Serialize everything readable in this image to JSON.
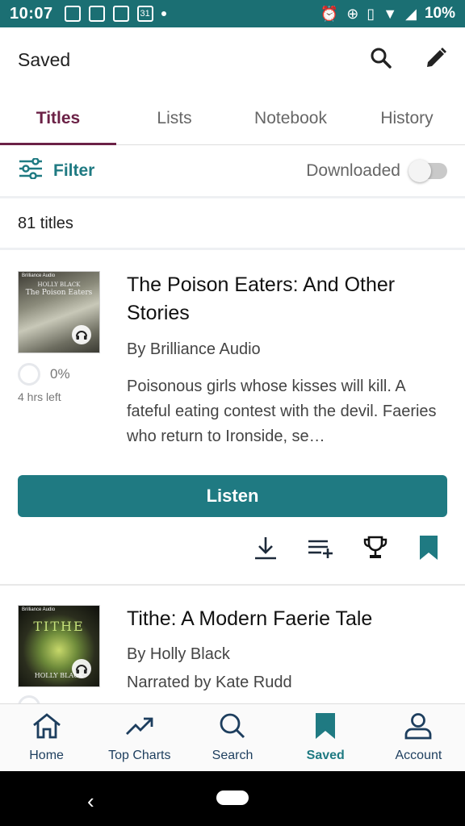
{
  "status_bar": {
    "time": "10:07",
    "calendar_day": "31",
    "battery": "10%"
  },
  "header": {
    "title": "Saved",
    "search_icon": "search-icon",
    "edit_icon": "edit-icon"
  },
  "tabs": [
    {
      "label": "Titles",
      "active": true
    },
    {
      "label": "Lists",
      "active": false
    },
    {
      "label": "Notebook",
      "active": false
    },
    {
      "label": "History",
      "active": false
    }
  ],
  "filter_bar": {
    "filter_label": "Filter",
    "downloaded_label": "Downloaded",
    "downloaded_on": false
  },
  "count_label": "81 titles",
  "books": [
    {
      "cover_brand": "Brilliance Audio",
      "cover_title": "The Poison Eaters",
      "cover_author": "HOLLY BLACK",
      "title": "The Poison Eaters: And Other Stories",
      "byline": "By Brilliance Audio",
      "description": "Poisonous girls whose kisses will kill. A fateful eating contest with the devil. Faeries who return to Ironside, se…",
      "progress": "0%",
      "time_left": "4 hrs left",
      "listen_label": "Listen"
    },
    {
      "cover_brand": "Brilliance Audio",
      "cover_title": "TITHE",
      "cover_author": "HOLLY BLACK",
      "title": "Tithe: A Modern Faerie Tale",
      "byline": "By Holly Black",
      "narrator": "Narrated by Kate Rudd"
    }
  ],
  "bottom_nav": [
    {
      "label": "Home",
      "icon": "home-icon",
      "active": false
    },
    {
      "label": "Top Charts",
      "icon": "trending-icon",
      "active": false
    },
    {
      "label": "Search",
      "icon": "search-icon",
      "active": false
    },
    {
      "label": "Saved",
      "icon": "bookmark-icon",
      "active": true
    },
    {
      "label": "Account",
      "icon": "account-icon",
      "active": false
    }
  ],
  "colors": {
    "status_bar": "#1b6f73",
    "accent": "#1f7a82",
    "tab_active": "#6b2146",
    "nav": "#1d3e5e"
  }
}
